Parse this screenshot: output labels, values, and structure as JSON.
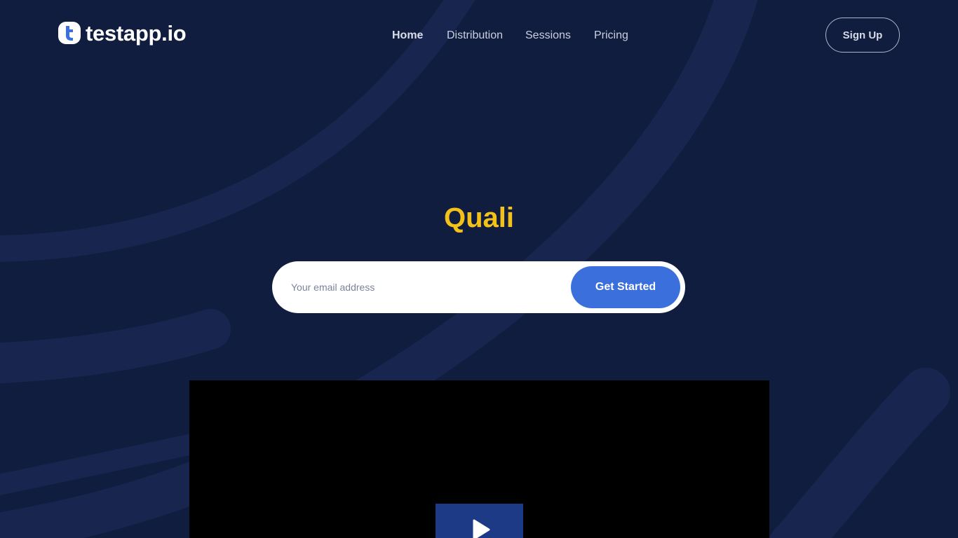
{
  "brand": {
    "name": "testapp.io",
    "icon": "testapp-logo-icon"
  },
  "nav": {
    "items": [
      {
        "label": "Home",
        "active": true
      },
      {
        "label": "Distribution",
        "active": false
      },
      {
        "label": "Sessions",
        "active": false
      },
      {
        "label": "Pricing",
        "active": false
      }
    ]
  },
  "header": {
    "signup_label": "Sign Up"
  },
  "hero": {
    "headline": "Quali",
    "email_placeholder": "Your email address",
    "cta_label": "Get Started"
  },
  "video": {
    "play_icon": "play-icon"
  },
  "colors": {
    "background": "#111d3e",
    "swirl": "#17254f",
    "headline": "#f3c21a",
    "cta": "#3b6fdc",
    "logo_accent": "#3b6fdc",
    "play_button": "#1c3a86"
  }
}
